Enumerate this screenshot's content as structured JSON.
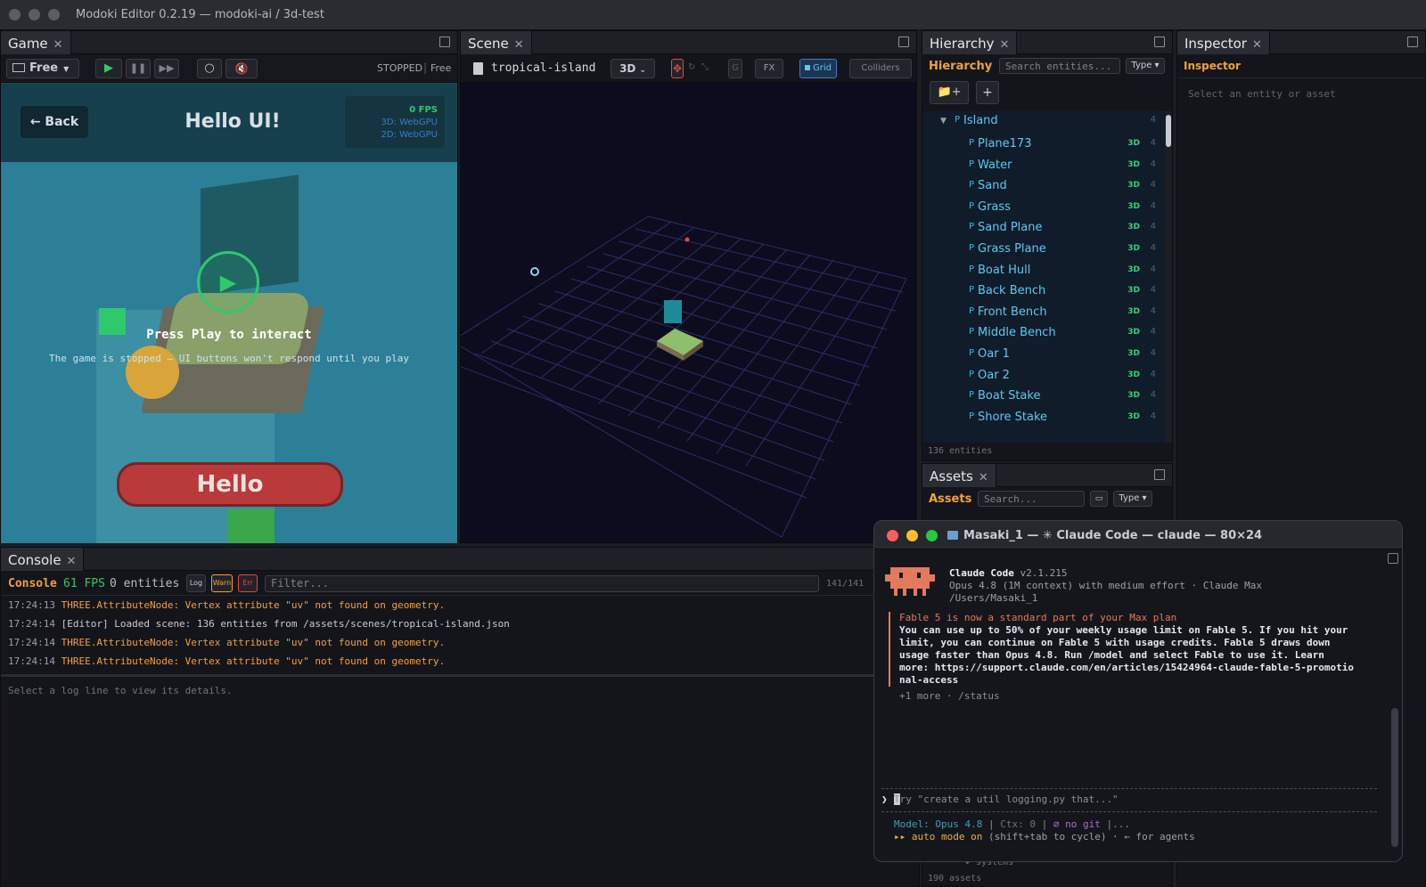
{
  "window": {
    "title": "Modoki Editor 0.2.19 — modoki-ai / 3d-test"
  },
  "game": {
    "tab_label": "Game",
    "view_mode": "Free",
    "status": "STOPPED",
    "status_mode": "Free",
    "back_label": "← Back",
    "heading": "Hello UI!",
    "fps": "0 FPS",
    "render_3d": "3D: WebGPU",
    "render_2d": "2D: WebGPU",
    "press_play": "Press Play to interact",
    "stopped_note": "The game is stopped — UI buttons won't respond until you play",
    "hello_button": "Hello"
  },
  "scene": {
    "tab_label": "Scene",
    "file_name": "tropical-island",
    "mode": "3D",
    "tool_g": "G",
    "fx_label": "FX",
    "grid_label": "Grid",
    "colliders_label": "Colliders"
  },
  "hierarchy": {
    "tab_label": "Hierarchy",
    "header": "Hierarchy",
    "search_placeholder": "Search entities...",
    "type_label": "Type",
    "root": {
      "name": "Island",
      "count": "4"
    },
    "items": [
      {
        "name": "Plane173",
        "badge": "3D",
        "count": "4"
      },
      {
        "name": "Water",
        "badge": "3D",
        "count": "4"
      },
      {
        "name": "Sand",
        "badge": "3D",
        "count": "4"
      },
      {
        "name": "Grass",
        "badge": "3D",
        "count": "4"
      },
      {
        "name": "Sand Plane",
        "badge": "3D",
        "count": "4"
      },
      {
        "name": "Grass Plane",
        "badge": "3D",
        "count": "4"
      },
      {
        "name": "Boat Hull",
        "badge": "3D",
        "count": "4"
      },
      {
        "name": "Back Bench",
        "badge": "3D",
        "count": "4"
      },
      {
        "name": "Front Bench",
        "badge": "3D",
        "count": "4"
      },
      {
        "name": "Middle Bench",
        "badge": "3D",
        "count": "4"
      },
      {
        "name": "Oar 1",
        "badge": "3D",
        "count": "4"
      },
      {
        "name": "Oar 2",
        "badge": "3D",
        "count": "4"
      },
      {
        "name": "Boat Stake",
        "badge": "3D",
        "count": "4"
      },
      {
        "name": "Shore Stake",
        "badge": "3D",
        "count": "4"
      }
    ],
    "entity_count": "136 entities"
  },
  "inspector": {
    "tab_label": "Inspector",
    "header": "Inspector",
    "placeholder": "Select an entity or asset"
  },
  "assets": {
    "tab_label": "Assets",
    "header": "Assets",
    "search_placeholder": "Search...",
    "type_label": "Type",
    "systems_label": "systems",
    "asset_count": "190 assets"
  },
  "console": {
    "tab_label": "Console",
    "header": "Console",
    "fps": "61 FPS",
    "entities": "0 entities",
    "filter_log": "Log",
    "filter_warn": "Warn",
    "filter_err": "Err",
    "filter_placeholder": "Filter...",
    "line_count": "141/141",
    "lines": [
      {
        "time": "17:24:13",
        "msg": "THREE.AttributeNode: Vertex attribute \"uv\" not found on geometry.",
        "level": "warn"
      },
      {
        "time": "17:24:14",
        "msg": "[Editor] Loaded scene: 136 entities from /assets/scenes/tropical-island.json",
        "level": "info"
      },
      {
        "time": "17:24:14",
        "msg": "THREE.AttributeNode: Vertex attribute \"uv\" not found on geometry.",
        "level": "warn"
      },
      {
        "time": "17:24:14",
        "msg": "THREE.AttributeNode: Vertex attribute \"uv\" not found on geometry.",
        "level": "warn"
      }
    ],
    "detail_placeholder": "Select a log line to view its details."
  },
  "terminal": {
    "title": "Masaki_1 — ✳ Claude Code — claude — 80×24",
    "app_name": "Claude Code",
    "version": "v2.1.215",
    "model_line": "Opus 4.8 (1M context) with medium effort · Claude Max",
    "cwd": "/Users/Masaki_1",
    "notice_title": "Fable 5 is now a standard part of your Max plan",
    "notice_lines": [
      "You can use up to 50% of your weekly usage limit on Fable 5. If you hit your",
      "limit, you can continue on Fable 5 with usage credits. Fable 5 draws down",
      "usage faster than Opus 4.8. Run /model and select Fable to use it. Learn",
      "more: https://support.claude.com/en/articles/15424964-claude-fable-5-promotio",
      "nal-access"
    ],
    "more_line": "+1 more · /status",
    "prompt_placeholder": "Try \"create a util logging.py that...\"",
    "status_model": "Model: Opus 4.8",
    "status_ctx": "Ctx: 0",
    "status_git": "⌀ no git",
    "status_more": "...",
    "auto_mode": "auto mode on",
    "auto_mode_hint": "(shift+tab to cycle) · ← for agents"
  },
  "colors": {
    "accent_orange": "#f0a13a",
    "accent_green": "#2fc96b",
    "accent_blue": "#5ec8ee",
    "claude_orange": "#e27a5b"
  }
}
